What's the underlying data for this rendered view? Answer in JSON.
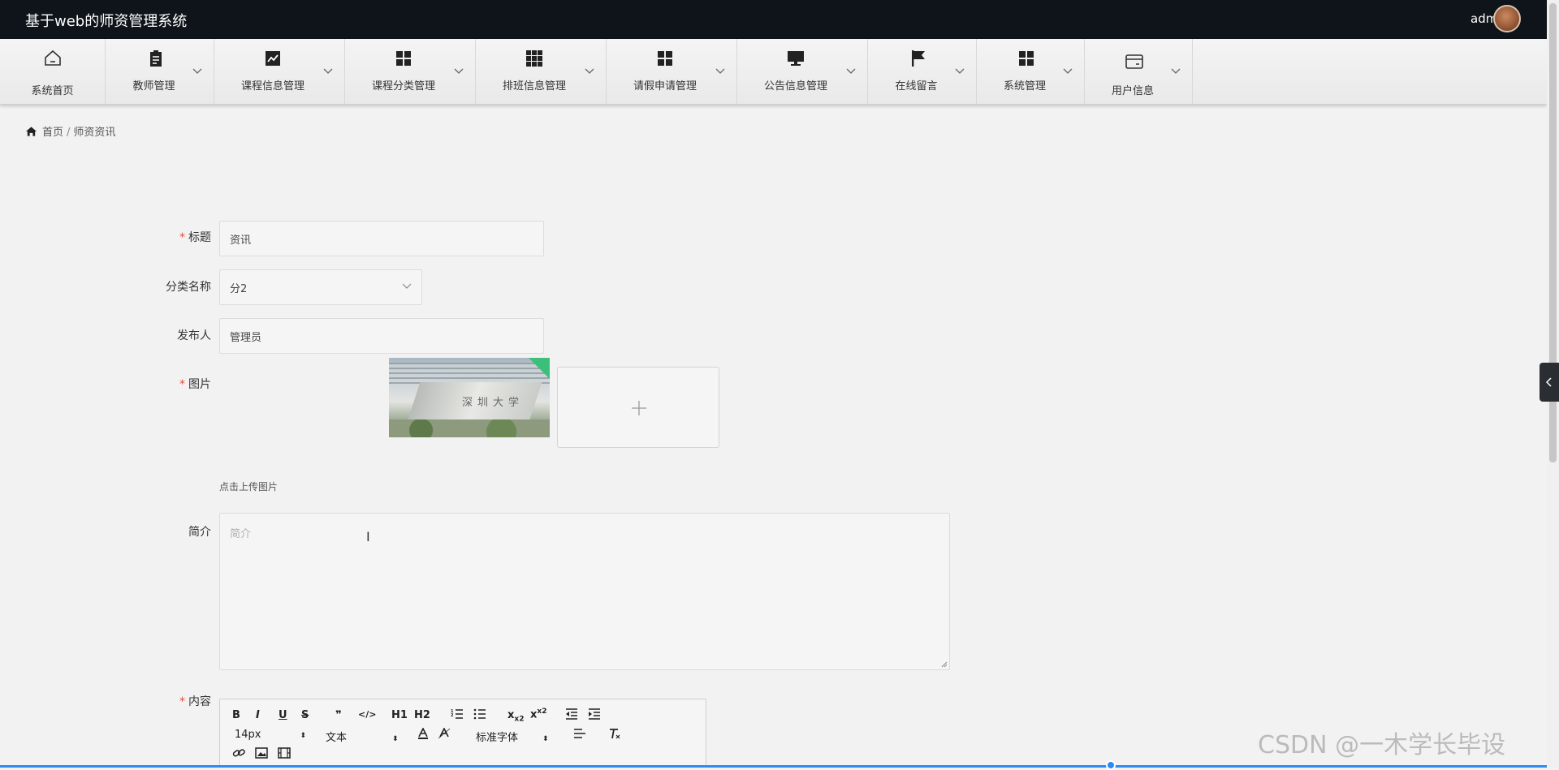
{
  "header": {
    "title": "基于web的师资管理系统",
    "username": "admin"
  },
  "nav": {
    "items": [
      {
        "label": "系统首页",
        "icon": "home-icon"
      },
      {
        "label": "教师管理",
        "icon": "clipboard-icon"
      },
      {
        "label": "课程信息管理",
        "icon": "chart-line-icon"
      },
      {
        "label": "课程分类管理",
        "icon": "grid-icon"
      },
      {
        "label": "排班信息管理",
        "icon": "grid-nine-icon"
      },
      {
        "label": "请假申请管理",
        "icon": "grid-icon"
      },
      {
        "label": "公告信息管理",
        "icon": "monitor-icon"
      },
      {
        "label": "在线留言",
        "icon": "flag-icon"
      },
      {
        "label": "系统管理",
        "icon": "grid-icon"
      },
      {
        "label": "用户信息",
        "icon": "card-icon"
      }
    ]
  },
  "breadcrumb": {
    "home": "首页",
    "separator": "/",
    "current": "师资资讯"
  },
  "form": {
    "title_label": "标题",
    "title_value": "资讯",
    "category_label": "分类名称",
    "category_value": "分2",
    "publisher_label": "发布人",
    "publisher_value": "管理员",
    "image_label": "图片",
    "image_hint": "点击上传图片",
    "summary_label": "简介",
    "summary_placeholder": "简介",
    "content_label": "内容",
    "required_mark": "*"
  },
  "editor": {
    "font_size": "14px",
    "block_format": "文本",
    "font_family": "标准字体",
    "buttons": [
      "B",
      "I",
      "U",
      "S",
      "❞",
      "</>",
      "H1",
      "H2",
      "x2",
      "x2"
    ]
  },
  "image_chars": "深圳大学",
  "watermark": "CSDN @一木学长毕设",
  "colors": {
    "header_bg": "#0e1419",
    "required": "#e74c3c",
    "accent": "#2d8cf0",
    "upload_corner": "#3cbf7b"
  }
}
